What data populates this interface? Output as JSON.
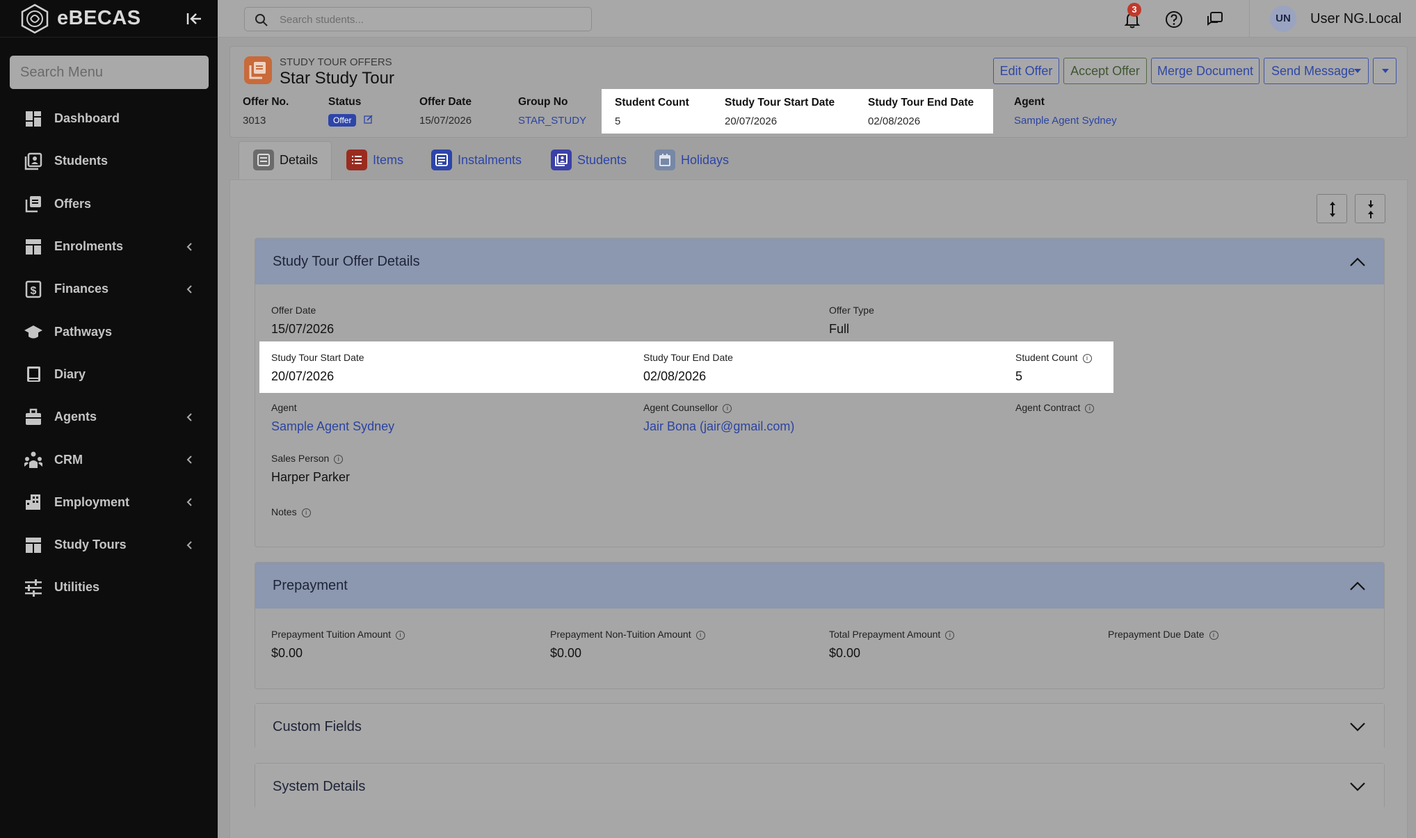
{
  "app": {
    "name": "eBECAS"
  },
  "sidebar": {
    "search_placeholder": "Search Menu",
    "items": [
      {
        "label": "Dashboard",
        "icon": "dashboard-icon"
      },
      {
        "label": "Students",
        "icon": "students-icon"
      },
      {
        "label": "Offers",
        "icon": "offers-icon"
      },
      {
        "label": "Enrolments",
        "icon": "enrolments-icon"
      },
      {
        "label": "Finances",
        "icon": "finances-icon"
      },
      {
        "label": "Pathways",
        "icon": "pathways-icon"
      },
      {
        "label": "Diary",
        "icon": "diary-icon"
      },
      {
        "label": "Agents",
        "icon": "agents-icon"
      },
      {
        "label": "CRM",
        "icon": "crm-icon"
      },
      {
        "label": "Employment",
        "icon": "employment-icon"
      },
      {
        "label": "Study Tours",
        "icon": "study-tours-icon"
      },
      {
        "label": "Utilities",
        "icon": "utilities-icon"
      }
    ]
  },
  "topbar": {
    "search_placeholder": "Search students...",
    "notification_count": "3",
    "user_initials": "UN",
    "user_name": "User NG.Local"
  },
  "header": {
    "kicker": "STUDY TOUR OFFERS",
    "title": "Star Study Tour",
    "buttons": {
      "edit": "Edit Offer",
      "accept": "Accept Offer",
      "merge": "Merge Document",
      "send": "Send Message"
    },
    "fields": {
      "offer_no_label": "Offer No.",
      "offer_no": "3013",
      "status_label": "Status",
      "status": "Offer",
      "offer_date_label": "Offer Date",
      "offer_date": "15/07/2026",
      "group_no_label": "Group No",
      "group_no": "STAR_STUDY",
      "student_count_label": "Student Count",
      "student_count": "5",
      "start_label": "Study Tour Start Date",
      "start": "20/07/2026",
      "end_label": "Study Tour End Date",
      "end": "02/08/2026",
      "agent_label": "Agent",
      "agent": "Sample Agent Sydney"
    }
  },
  "tabs": [
    "Details",
    "Items",
    "Instalments",
    "Students",
    "Holidays"
  ],
  "details": {
    "title": "Study Tour Offer Details",
    "offer_date_label": "Offer Date",
    "offer_date": "15/07/2026",
    "offer_type_label": "Offer Type",
    "offer_type": "Full",
    "start_label": "Study Tour Start Date",
    "start": "20/07/2026",
    "end_label": "Study Tour End Date",
    "end": "02/08/2026",
    "count_label": "Student Count",
    "count": "5",
    "agent_label": "Agent",
    "agent": "Sample Agent Sydney",
    "counsellor_label": "Agent Counsellor",
    "counsellor": "Jair Bona (jair@gmail.com)",
    "contract_label": "Agent Contract",
    "sales_label": "Sales Person",
    "sales": "Harper Parker",
    "notes_label": "Notes"
  },
  "prepayment": {
    "title": "Prepayment",
    "tuition_label": "Prepayment Tuition Amount",
    "tuition": "$0.00",
    "non_tuition_label": "Prepayment Non-Tuition Amount",
    "non_tuition": "$0.00",
    "total_label": "Total Prepayment Amount",
    "total": "$0.00",
    "due_label": "Prepayment Due Date"
  },
  "custom_fields": {
    "title": "Custom Fields"
  },
  "system_details": {
    "title": "System Details"
  },
  "info_glyph": "i"
}
